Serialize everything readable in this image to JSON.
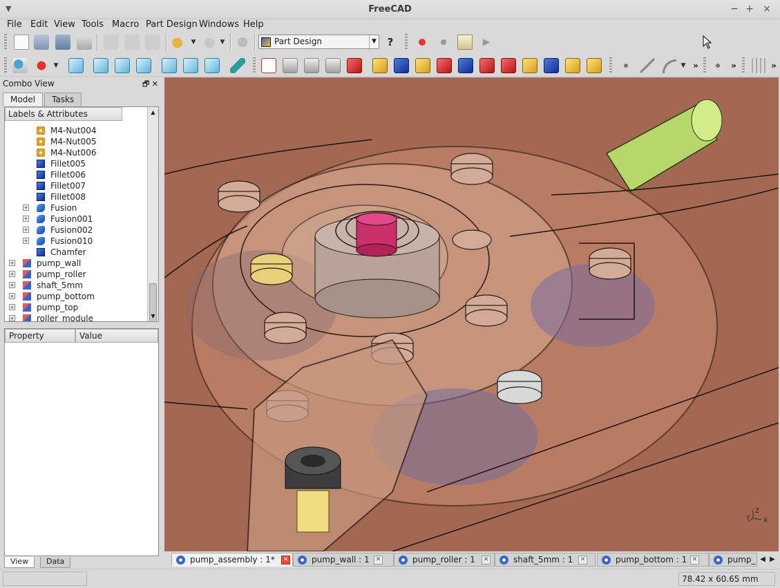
{
  "window": {
    "title": "FreeCAD",
    "controls": [
      "−",
      "+",
      "×"
    ]
  },
  "menu": [
    "File",
    "Edit",
    "View",
    "Tools",
    "Macro",
    "Part Design",
    "Windows",
    "Help"
  ],
  "toolbar": {
    "workbench": "Part Design",
    "more": "»"
  },
  "combo": {
    "title": "Combo View",
    "tabs": [
      "Model",
      "Tasks"
    ],
    "tree_header": "Labels & Attributes",
    "items": [
      {
        "label": "M4-Nut004",
        "icon": "nut-icon",
        "level": 2,
        "expand": ""
      },
      {
        "label": "M4-Nut005",
        "icon": "nut-icon",
        "level": 2,
        "expand": ""
      },
      {
        "label": "M4-Nut006",
        "icon": "nut-icon",
        "level": 2,
        "expand": ""
      },
      {
        "label": "Fillet005",
        "icon": "fillet-icon",
        "level": 2,
        "expand": ""
      },
      {
        "label": "Fillet006",
        "icon": "fillet-icon",
        "level": 2,
        "expand": ""
      },
      {
        "label": "Fillet007",
        "icon": "fillet-icon",
        "level": 2,
        "expand": ""
      },
      {
        "label": "Fillet008",
        "icon": "fillet-icon",
        "level": 2,
        "expand": ""
      },
      {
        "label": "Fusion",
        "icon": "fusion-icon",
        "level": 2,
        "expand": "+"
      },
      {
        "label": "Fusion001",
        "icon": "fusion-icon",
        "level": 2,
        "expand": "+"
      },
      {
        "label": "Fusion002",
        "icon": "fusion-icon",
        "level": 2,
        "expand": "+"
      },
      {
        "label": "Fusion010",
        "icon": "fusion-icon",
        "level": 2,
        "expand": "+"
      },
      {
        "label": "Chamfer",
        "icon": "chamfer-icon",
        "level": 2,
        "expand": ""
      },
      {
        "label": "pump_wall",
        "icon": "part-icon",
        "level": 1,
        "expand": "+"
      },
      {
        "label": "pump_roller",
        "icon": "part-icon",
        "level": 1,
        "expand": "+"
      },
      {
        "label": "shaft_5mm",
        "icon": "part-icon",
        "level": 1,
        "expand": "+"
      },
      {
        "label": "pump_bottom",
        "icon": "part-icon",
        "level": 1,
        "expand": "+"
      },
      {
        "label": "pump_top",
        "icon": "part-icon",
        "level": 1,
        "expand": "+"
      },
      {
        "label": "roller_module",
        "icon": "part-icon",
        "level": 1,
        "expand": "+"
      }
    ],
    "property_header": "Property",
    "value_header": "Value",
    "subtabs": [
      "View",
      "Data"
    ]
  },
  "doc_tabs": [
    {
      "label": "pump_assembly : 1*",
      "active": true
    },
    {
      "label": "pump_wall : 1",
      "active": false
    },
    {
      "label": "pump_roller : 1",
      "active": false
    },
    {
      "label": "shaft_5mm : 1",
      "active": false
    },
    {
      "label": "pump_bottom : 1",
      "active": false
    },
    {
      "label": "pump_",
      "active": false
    }
  ],
  "status": {
    "dimensions": "78.42 x 60.65 mm"
  },
  "axes": {
    "z": "Z",
    "y": "Y",
    "x": "X"
  }
}
